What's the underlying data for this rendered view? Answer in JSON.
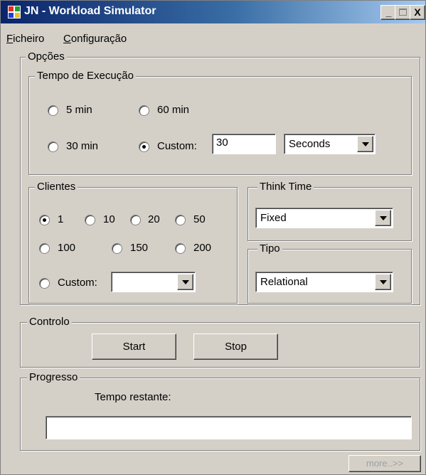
{
  "window": {
    "title": "JN - Workload Simulator",
    "minimize": "_",
    "close": "X"
  },
  "menu": {
    "items": [
      {
        "mnemonic": "F",
        "rest": "icheiro"
      },
      {
        "mnemonic": "C",
        "rest": "onfiguração"
      }
    ]
  },
  "options": {
    "legend": "Opções",
    "execution_time": {
      "legend": "Tempo de Execução",
      "radios": [
        "5 min",
        "60 min",
        "30 min",
        "Custom:"
      ],
      "selected": "Custom:",
      "custom_value": "30",
      "unit": "Seconds"
    },
    "clients": {
      "legend": "Clientes",
      "radios": [
        "1",
        "10",
        "20",
        "50",
        "100",
        "150",
        "200",
        "Custom:"
      ],
      "selected": "1",
      "custom_value": ""
    },
    "think_time": {
      "legend": "Think Time",
      "value": "Fixed"
    },
    "type": {
      "legend": "Tipo",
      "value": "Relational"
    }
  },
  "control": {
    "legend": "Controlo",
    "start_label": "Start",
    "stop_label": "Stop"
  },
  "progress": {
    "legend": "Progresso",
    "remaining_label": "Tempo restante:",
    "value": 0
  },
  "footer": {
    "more_label": "more..>>"
  }
}
